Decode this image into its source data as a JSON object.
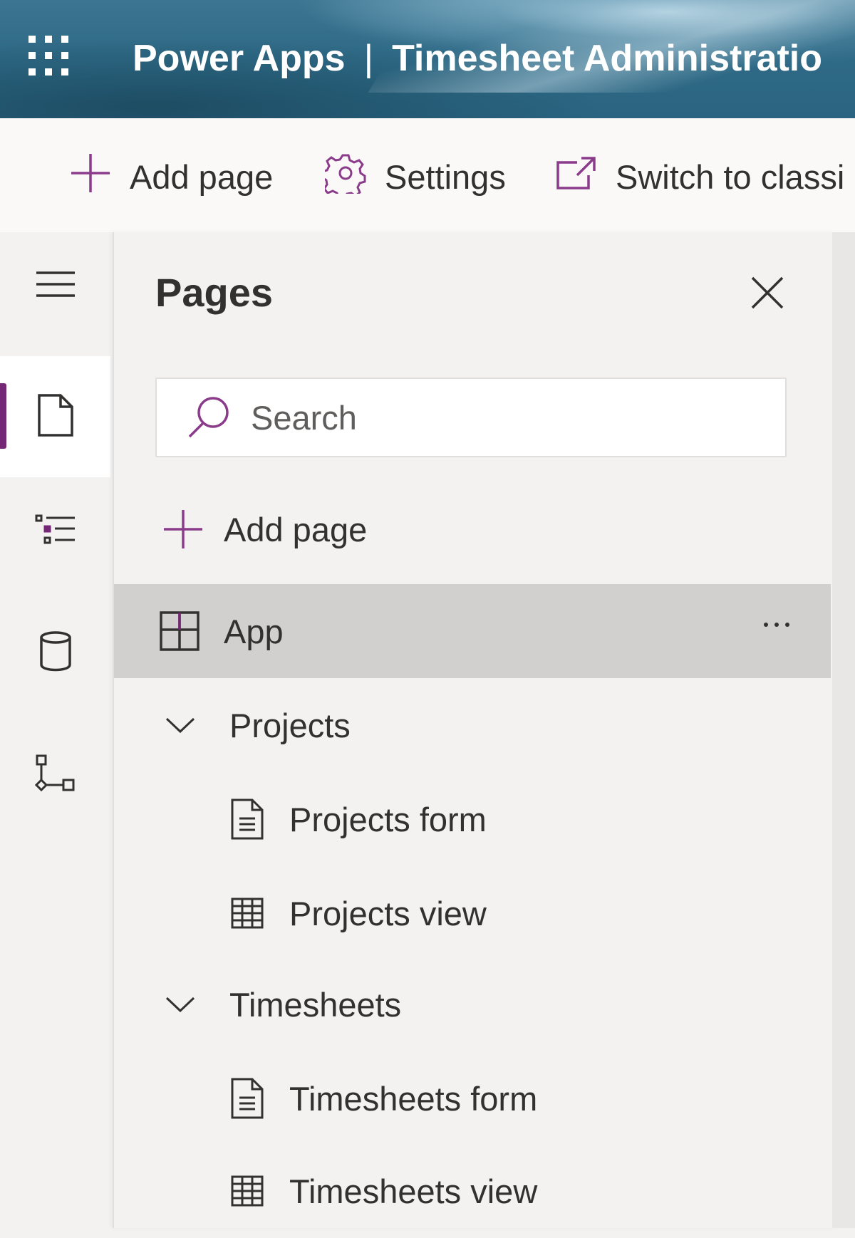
{
  "header": {
    "app_name": "Power Apps",
    "separator": "|",
    "app_title": "Timesheet Administratio"
  },
  "command_bar": {
    "add_page_label": "Add page",
    "settings_label": "Settings",
    "switch_label": "Switch to classi"
  },
  "rail": {
    "items": [
      "menu-toggle",
      "pages",
      "navigation",
      "data",
      "automation"
    ],
    "active": "pages"
  },
  "pages_panel": {
    "title": "Pages",
    "search": {
      "placeholder": "Search",
      "value": ""
    },
    "add_page_label": "Add page",
    "tree": [
      {
        "label": "App",
        "icon": "app-layout-icon",
        "selected": true
      },
      {
        "label": "Projects",
        "icon": "chevron-down-icon",
        "children": [
          {
            "label": "Projects form",
            "icon": "form-icon"
          },
          {
            "label": "Projects view",
            "icon": "table-icon"
          }
        ]
      },
      {
        "label": "Timesheets",
        "icon": "chevron-down-icon",
        "children": [
          {
            "label": "Timesheets form",
            "icon": "form-icon"
          },
          {
            "label": "Timesheets view",
            "icon": "table-icon"
          }
        ]
      }
    ]
  },
  "colors": {
    "accent_purple": "#742774",
    "icon_purple": "#8a3c8a",
    "panel_bg": "#f3f2f1",
    "selected_row_bg": "#d2d0ce"
  }
}
